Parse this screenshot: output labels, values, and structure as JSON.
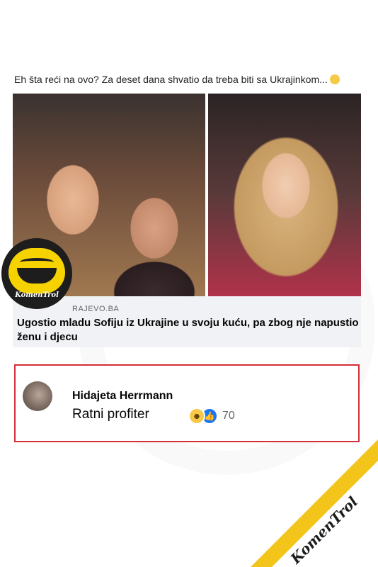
{
  "post": {
    "text": "Eh šta reći na ovo? Za deset dana shvatio da treba biti sa Ukrajinkom...",
    "emoji_icon": "worried-face-emoji"
  },
  "link": {
    "domain": "RAJEVO.BA",
    "title": "Ugostio mladu Sofiju iz Ukrajine u svoju kuću, pa zbog nje napustio ženu i djecu"
  },
  "comment": {
    "author": "Hidajeta Herrmann",
    "text": "Ratni profiter",
    "reactions": [
      "haha",
      "like"
    ],
    "reaction_count": "70"
  },
  "branding": {
    "badge_label": "KomenTrol",
    "corner_label": "KomenTrol",
    "accent_color": "#f3c51a",
    "highlight_color": "#d32f3a"
  }
}
